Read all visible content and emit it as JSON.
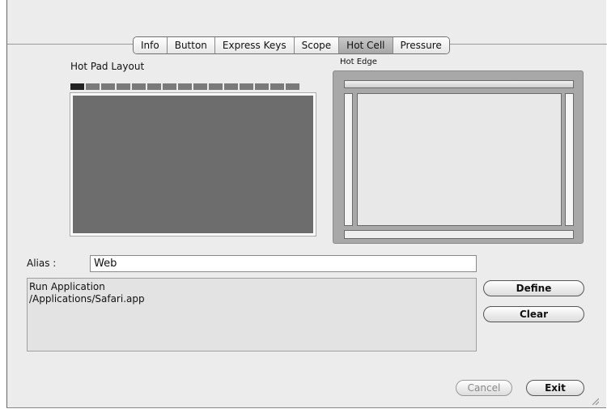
{
  "tabs": [
    {
      "label": "Info",
      "selected": false
    },
    {
      "label": "Button",
      "selected": false
    },
    {
      "label": "Express Keys",
      "selected": false
    },
    {
      "label": "Scope",
      "selected": false
    },
    {
      "label": "Hot Cell",
      "selected": true
    },
    {
      "label": "Pressure",
      "selected": false
    }
  ],
  "hot_pad": {
    "title": "Hot Pad Layout",
    "cell_count": 15,
    "active_cell_index": 0
  },
  "hot_edge": {
    "title": "Hot Edge"
  },
  "alias": {
    "label": "Alias :",
    "value": "Web"
  },
  "action": {
    "line1": "Run Application",
    "line2": "/Applications/Safari.app"
  },
  "buttons": {
    "define": "Define",
    "clear": "Clear",
    "cancel": "Cancel",
    "exit": "Exit"
  },
  "colors": {
    "pad_fill": "#6d6d6d",
    "active_cell": "#222222",
    "selected_tab": "#b0b0b0"
  }
}
